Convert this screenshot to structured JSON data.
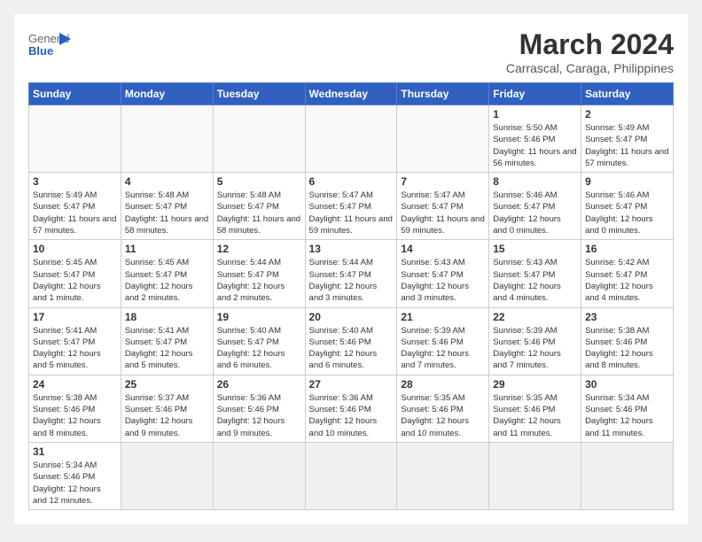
{
  "header": {
    "logo_general": "General",
    "logo_blue": "Blue",
    "month_year": "March 2024",
    "location": "Carrascal, Caraga, Philippines"
  },
  "days_of_week": [
    "Sunday",
    "Monday",
    "Tuesday",
    "Wednesday",
    "Thursday",
    "Friday",
    "Saturday"
  ],
  "weeks": [
    [
      {
        "day": "",
        "info": ""
      },
      {
        "day": "",
        "info": ""
      },
      {
        "day": "",
        "info": ""
      },
      {
        "day": "",
        "info": ""
      },
      {
        "day": "",
        "info": ""
      },
      {
        "day": "1",
        "info": "Sunrise: 5:50 AM\nSunset: 5:46 PM\nDaylight: 11 hours and 56 minutes."
      },
      {
        "day": "2",
        "info": "Sunrise: 5:49 AM\nSunset: 5:47 PM\nDaylight: 11 hours and 57 minutes."
      }
    ],
    [
      {
        "day": "3",
        "info": "Sunrise: 5:49 AM\nSunset: 5:47 PM\nDaylight: 11 hours and 57 minutes."
      },
      {
        "day": "4",
        "info": "Sunrise: 5:48 AM\nSunset: 5:47 PM\nDaylight: 11 hours and 58 minutes."
      },
      {
        "day": "5",
        "info": "Sunrise: 5:48 AM\nSunset: 5:47 PM\nDaylight: 11 hours and 58 minutes."
      },
      {
        "day": "6",
        "info": "Sunrise: 5:47 AM\nSunset: 5:47 PM\nDaylight: 11 hours and 59 minutes."
      },
      {
        "day": "7",
        "info": "Sunrise: 5:47 AM\nSunset: 5:47 PM\nDaylight: 11 hours and 59 minutes."
      },
      {
        "day": "8",
        "info": "Sunrise: 5:46 AM\nSunset: 5:47 PM\nDaylight: 12 hours and 0 minutes."
      },
      {
        "day": "9",
        "info": "Sunrise: 5:46 AM\nSunset: 5:47 PM\nDaylight: 12 hours and 0 minutes."
      }
    ],
    [
      {
        "day": "10",
        "info": "Sunrise: 5:45 AM\nSunset: 5:47 PM\nDaylight: 12 hours and 1 minute."
      },
      {
        "day": "11",
        "info": "Sunrise: 5:45 AM\nSunset: 5:47 PM\nDaylight: 12 hours and 2 minutes."
      },
      {
        "day": "12",
        "info": "Sunrise: 5:44 AM\nSunset: 5:47 PM\nDaylight: 12 hours and 2 minutes."
      },
      {
        "day": "13",
        "info": "Sunrise: 5:44 AM\nSunset: 5:47 PM\nDaylight: 12 hours and 3 minutes."
      },
      {
        "day": "14",
        "info": "Sunrise: 5:43 AM\nSunset: 5:47 PM\nDaylight: 12 hours and 3 minutes."
      },
      {
        "day": "15",
        "info": "Sunrise: 5:43 AM\nSunset: 5:47 PM\nDaylight: 12 hours and 4 minutes."
      },
      {
        "day": "16",
        "info": "Sunrise: 5:42 AM\nSunset: 5:47 PM\nDaylight: 12 hours and 4 minutes."
      }
    ],
    [
      {
        "day": "17",
        "info": "Sunrise: 5:41 AM\nSunset: 5:47 PM\nDaylight: 12 hours and 5 minutes."
      },
      {
        "day": "18",
        "info": "Sunrise: 5:41 AM\nSunset: 5:47 PM\nDaylight: 12 hours and 5 minutes."
      },
      {
        "day": "19",
        "info": "Sunrise: 5:40 AM\nSunset: 5:47 PM\nDaylight: 12 hours and 6 minutes."
      },
      {
        "day": "20",
        "info": "Sunrise: 5:40 AM\nSunset: 5:46 PM\nDaylight: 12 hours and 6 minutes."
      },
      {
        "day": "21",
        "info": "Sunrise: 5:39 AM\nSunset: 5:46 PM\nDaylight: 12 hours and 7 minutes."
      },
      {
        "day": "22",
        "info": "Sunrise: 5:39 AM\nSunset: 5:46 PM\nDaylight: 12 hours and 7 minutes."
      },
      {
        "day": "23",
        "info": "Sunrise: 5:38 AM\nSunset: 5:46 PM\nDaylight: 12 hours and 8 minutes."
      }
    ],
    [
      {
        "day": "24",
        "info": "Sunrise: 5:38 AM\nSunset: 5:46 PM\nDaylight: 12 hours and 8 minutes."
      },
      {
        "day": "25",
        "info": "Sunrise: 5:37 AM\nSunset: 5:46 PM\nDaylight: 12 hours and 9 minutes."
      },
      {
        "day": "26",
        "info": "Sunrise: 5:36 AM\nSunset: 5:46 PM\nDaylight: 12 hours and 9 minutes."
      },
      {
        "day": "27",
        "info": "Sunrise: 5:36 AM\nSunset: 5:46 PM\nDaylight: 12 hours and 10 minutes."
      },
      {
        "day": "28",
        "info": "Sunrise: 5:35 AM\nSunset: 5:46 PM\nDaylight: 12 hours and 10 minutes."
      },
      {
        "day": "29",
        "info": "Sunrise: 5:35 AM\nSunset: 5:46 PM\nDaylight: 12 hours and 11 minutes."
      },
      {
        "day": "30",
        "info": "Sunrise: 5:34 AM\nSunset: 5:46 PM\nDaylight: 12 hours and 11 minutes."
      }
    ],
    [
      {
        "day": "31",
        "info": "Sunrise: 5:34 AM\nSunset: 5:46 PM\nDaylight: 12 hours and 12 minutes."
      },
      {
        "day": "",
        "info": ""
      },
      {
        "day": "",
        "info": ""
      },
      {
        "day": "",
        "info": ""
      },
      {
        "day": "",
        "info": ""
      },
      {
        "day": "",
        "info": ""
      },
      {
        "day": "",
        "info": ""
      }
    ]
  ]
}
